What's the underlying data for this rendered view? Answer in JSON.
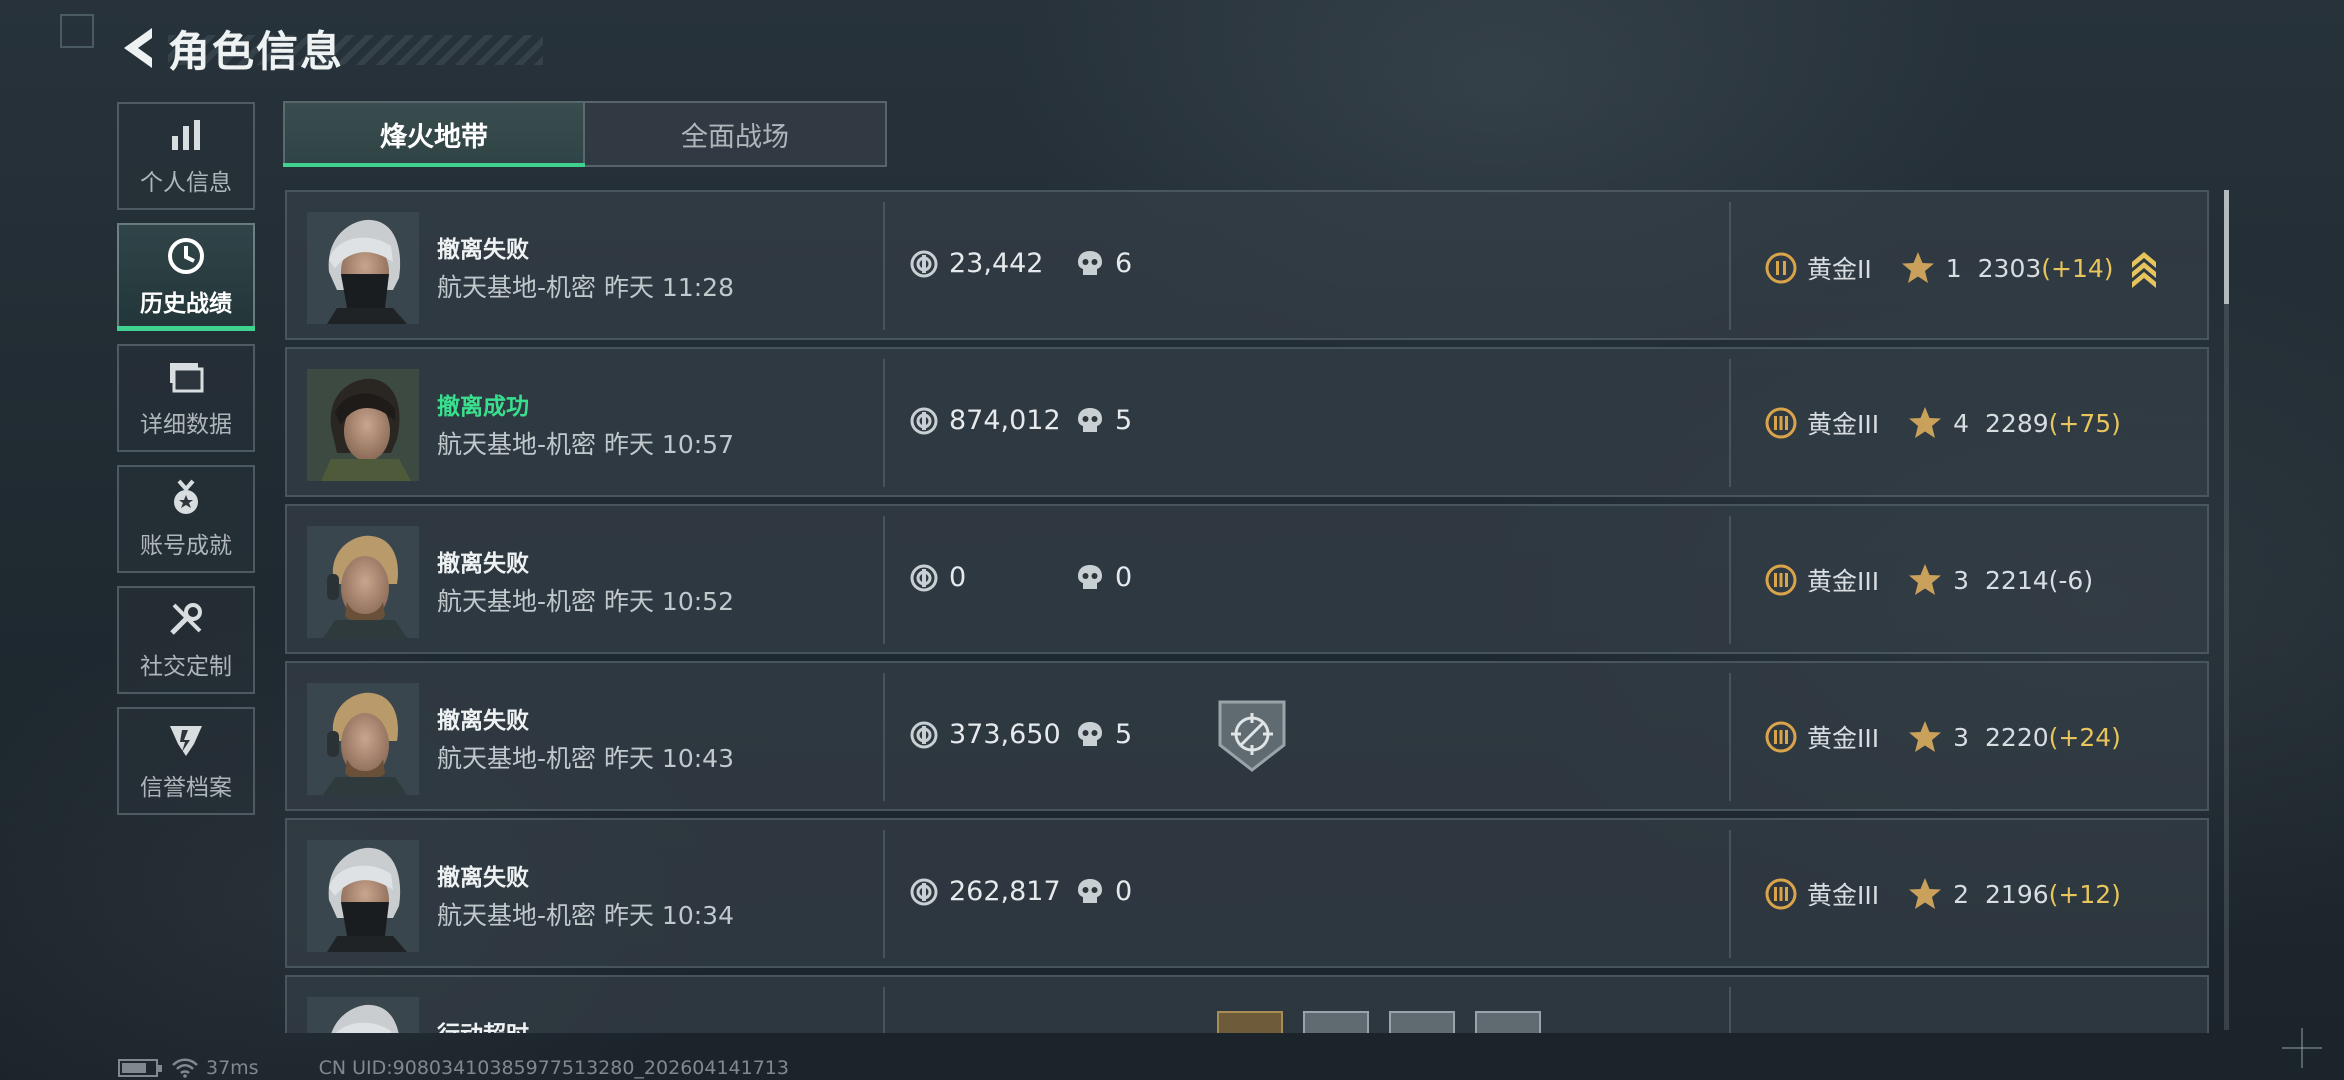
{
  "header": {
    "title": "角色信息"
  },
  "sidebar": {
    "items": [
      {
        "label": "个人信息",
        "icon": "bar-chart-icon",
        "active": false
      },
      {
        "label": "历史战绩",
        "icon": "clock-history-icon",
        "active": true
      },
      {
        "label": "详细数据",
        "icon": "folder-data-icon",
        "active": false
      },
      {
        "label": "账号成就",
        "icon": "medal-achievement-icon",
        "active": false
      },
      {
        "label": "社交定制",
        "icon": "wrench-tools-icon",
        "active": false
      },
      {
        "label": "信誉档案",
        "icon": "shield-reputation-icon",
        "active": false
      }
    ]
  },
  "tabs": [
    {
      "label": "烽火地带",
      "active": true
    },
    {
      "label": "全面战场",
      "active": false
    }
  ],
  "matches": [
    {
      "result": "撤离失败",
      "success": false,
      "map": "航天基地-机密",
      "time": "昨天 11:28",
      "value": "23,442",
      "kills": "6",
      "rank_tier": "II",
      "rank": "黄金II",
      "stars": "1",
      "score": "2303",
      "delta": "(+14)",
      "delta_positive": true,
      "medal": false,
      "rank_up": true,
      "avatar": "white-hair-masked"
    },
    {
      "result": "撤离成功",
      "success": true,
      "map": "航天基地-机密",
      "time": "昨天 10:57",
      "value": "874,012",
      "kills": "5",
      "rank_tier": "III",
      "rank": "黄金III",
      "stars": "4",
      "score": "2289",
      "delta": "(+75)",
      "delta_positive": true,
      "medal": false,
      "rank_up": false,
      "avatar": "dark-hair-green"
    },
    {
      "result": "撤离失败",
      "success": false,
      "map": "航天基地-机密",
      "time": "昨天 10:52",
      "value": "0",
      "kills": "0",
      "rank_tier": "III",
      "rank": "黄金III",
      "stars": "3",
      "score": "2214",
      "delta": "(-6)",
      "delta_positive": false,
      "medal": false,
      "rank_up": false,
      "avatar": "blond-headset"
    },
    {
      "result": "撤离失败",
      "success": false,
      "map": "航天基地-机密",
      "time": "昨天 10:43",
      "value": "373,650",
      "kills": "5",
      "rank_tier": "III",
      "rank": "黄金III",
      "stars": "3",
      "score": "2220",
      "delta": "(+24)",
      "delta_positive": true,
      "medal": true,
      "rank_up": false,
      "avatar": "blond-headset"
    },
    {
      "result": "撤离失败",
      "success": false,
      "map": "航天基地-机密",
      "time": "昨天 10:34",
      "value": "262,817",
      "kills": "0",
      "rank_tier": "III",
      "rank": "黄金III",
      "stars": "2",
      "score": "2196",
      "delta": "(+12)",
      "delta_positive": true,
      "medal": false,
      "rank_up": false,
      "avatar": "white-hair-masked"
    },
    {
      "result": "行动超时",
      "success": false,
      "map": "",
      "time": "",
      "value": "",
      "kills": "",
      "rank_tier": "",
      "rank": "",
      "stars": "",
      "score": "",
      "delta": "",
      "delta_positive": true,
      "medal": false,
      "rank_up": false,
      "avatar": "white-hair-masked",
      "partial": true
    }
  ],
  "status": {
    "ping": "37ms",
    "uid": "CN UID:9080341038597751328​0_202604141713"
  },
  "colors": {
    "accent": "#3fd38f",
    "success": "#38e08e",
    "gold": "#e7c55c"
  }
}
